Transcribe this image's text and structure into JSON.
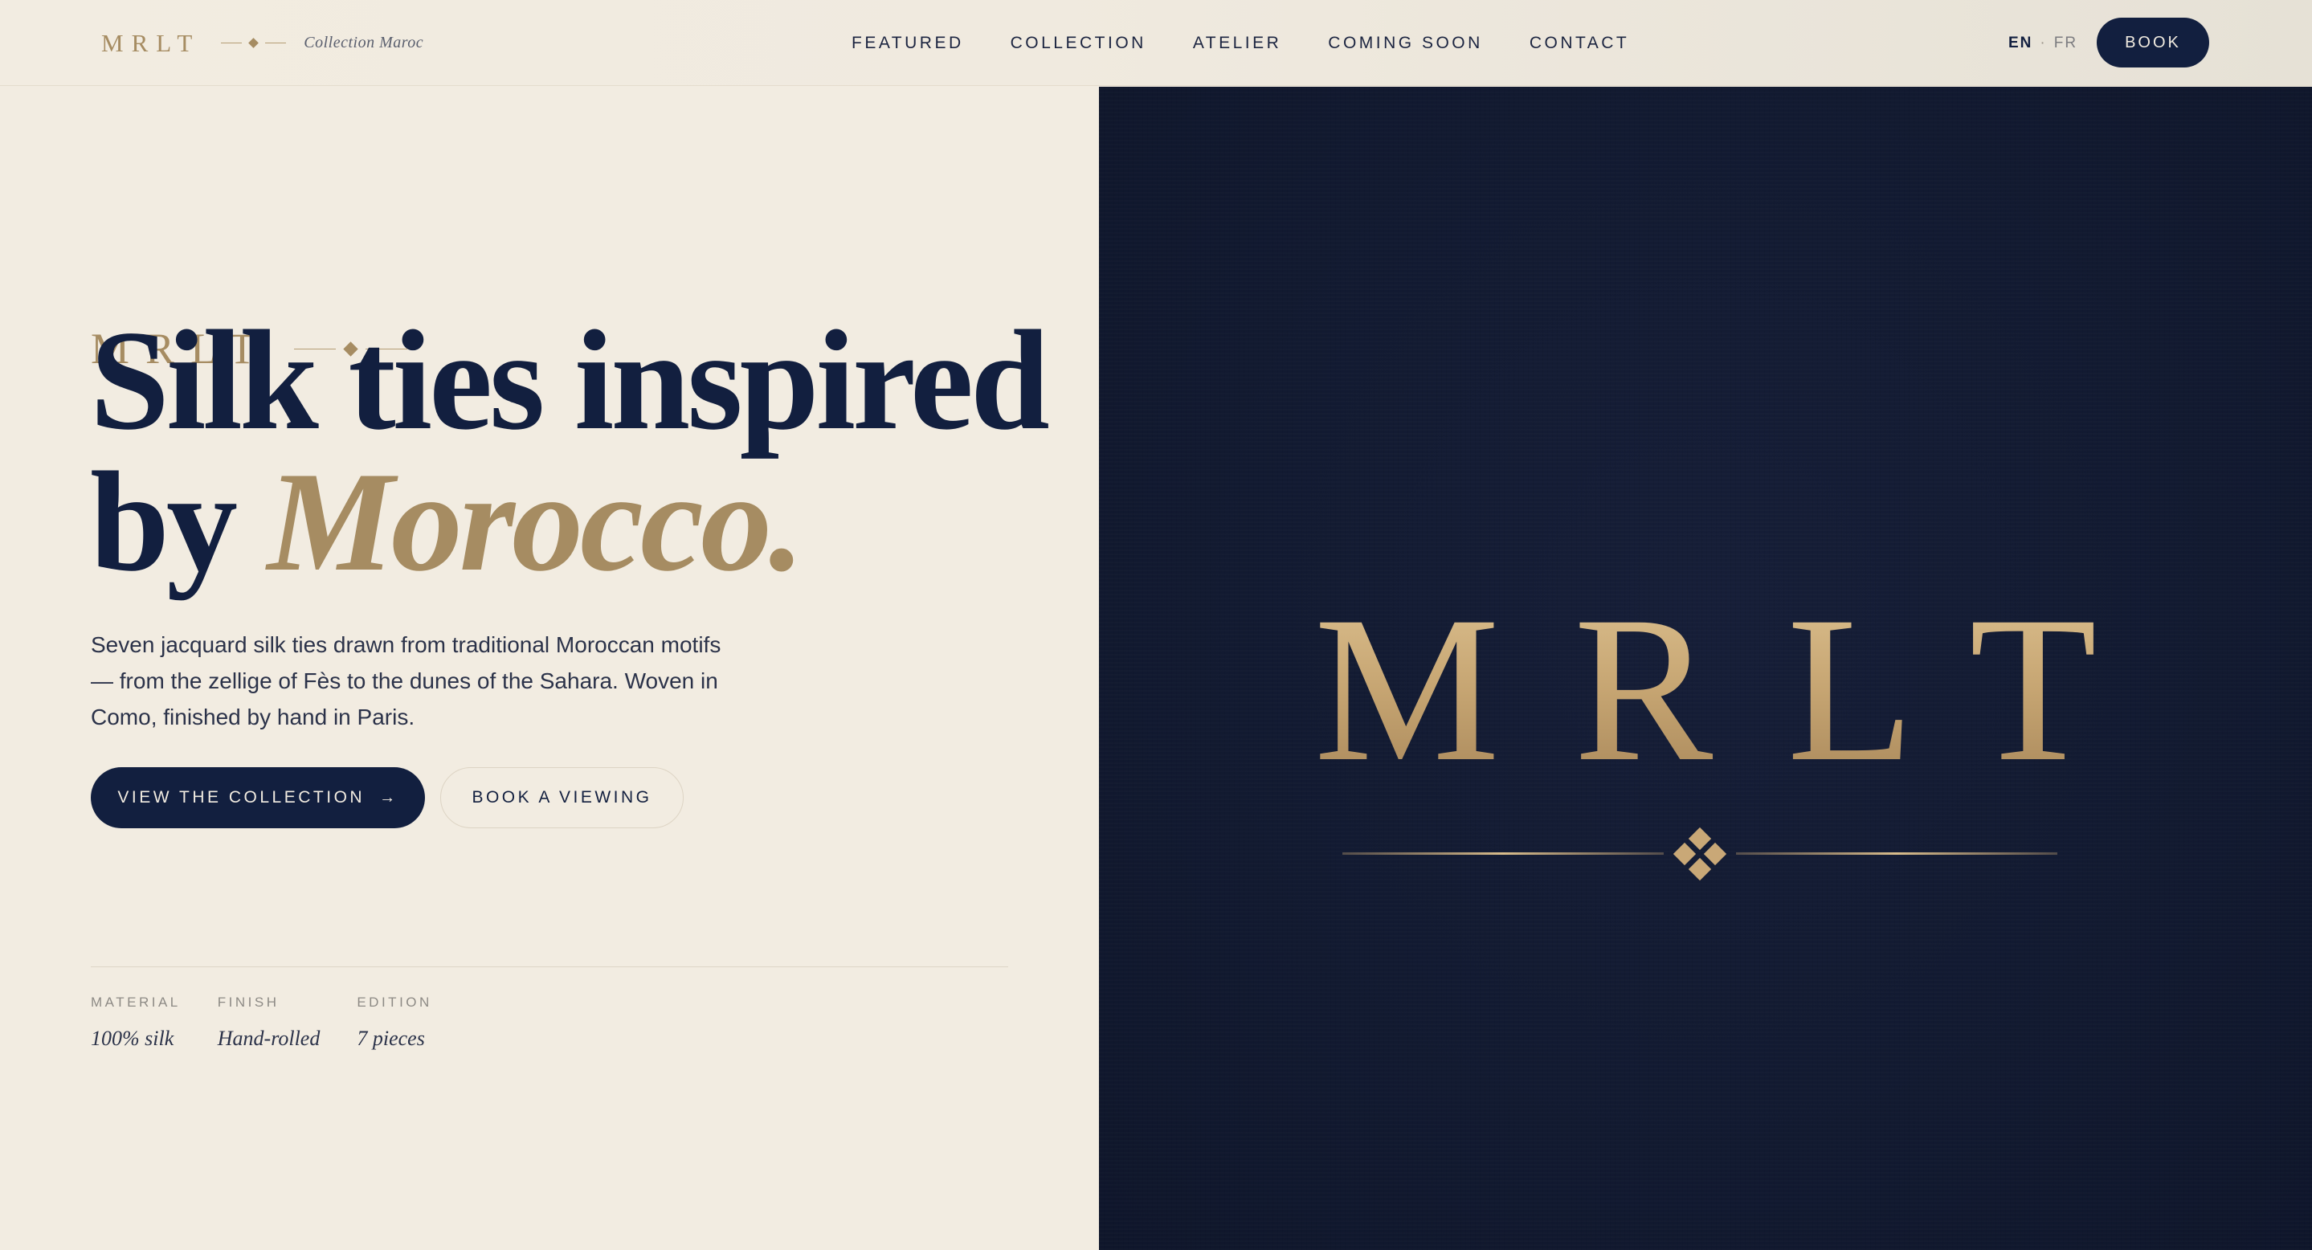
{
  "header": {
    "brand": "MRLT",
    "brand_sub": "Collection Maroc",
    "nav": [
      "FEATURED",
      "COLLECTION",
      "ATELIER",
      "COMING SOON",
      "CONTACT"
    ],
    "lang_active": "EN",
    "lang_sep": "·",
    "lang_other": "FR",
    "book_label": "BOOK"
  },
  "hero": {
    "eyebrow": "MRLT",
    "headline_line1": "Silk ties inspired",
    "headline_line2_start": "by ",
    "headline_accent": "Morocco.",
    "lead": "Seven jacquard silk ties drawn from traditional Moroccan motifs — from the zellige of Fès to the dunes of the Sahara. Woven in Como, finished by hand in Paris.",
    "cta_primary": "VIEW THE COLLECTION",
    "cta_primary_icon": "arrow-right-icon",
    "cta_secondary": "BOOK A VIEWING",
    "specs": [
      {
        "label": "MATERIAL",
        "value": "100% silk"
      },
      {
        "label": "FINISH",
        "value": "Hand-rolled"
      },
      {
        "label": "EDITION",
        "value": "7 pieces"
      }
    ]
  },
  "image": {
    "logo_text": "MRLT"
  },
  "colors": {
    "navy": "#121f3f",
    "gold": "#a68c62",
    "cream": "#f2ece1"
  }
}
